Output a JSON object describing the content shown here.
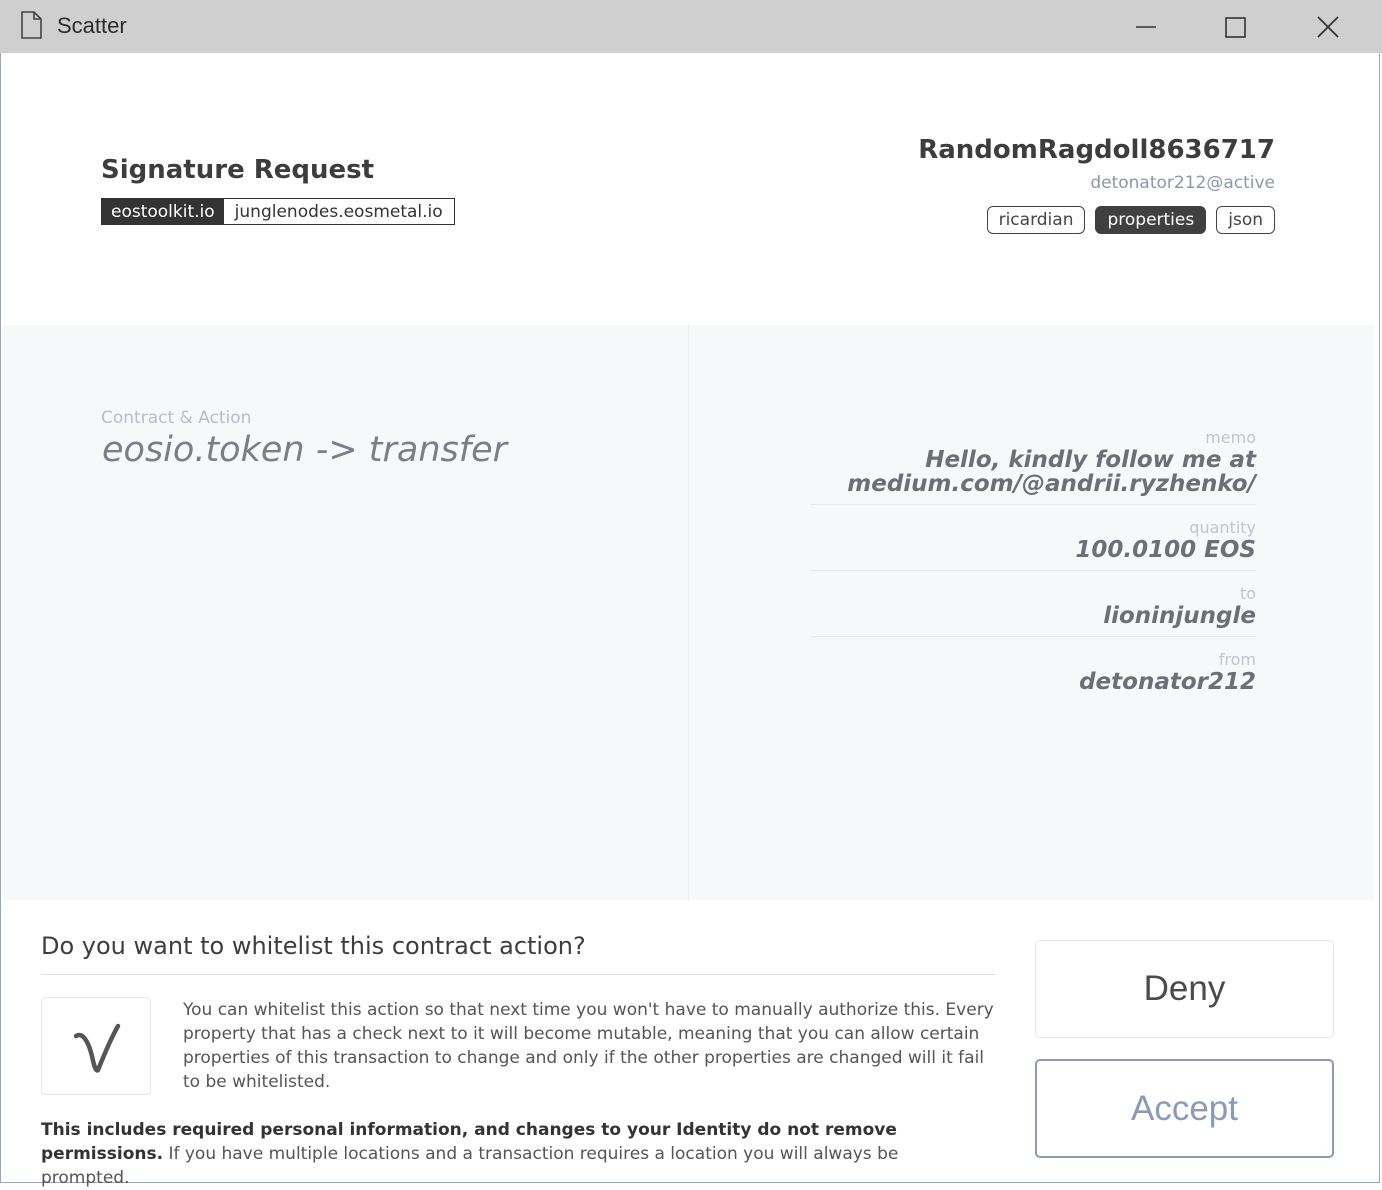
{
  "window": {
    "title": "Scatter",
    "controls": [
      "minimize",
      "maximize",
      "close"
    ]
  },
  "header": {
    "title": "Signature Request",
    "origin_app": "eostoolkit.io",
    "origin_network": "junglenodes.eosmetal.io",
    "account_name": "RandomRagdoll8636717",
    "account_permission": "detonator212@active",
    "tabs": [
      {
        "label": "ricardian",
        "active": false
      },
      {
        "label": "properties",
        "active": true
      },
      {
        "label": "json",
        "active": false
      }
    ]
  },
  "action": {
    "label": "Contract & Action",
    "value": "eosio.token -> transfer"
  },
  "properties": [
    {
      "key": "memo",
      "value_line1": "Hello, kindly follow me at",
      "value_line2": "medium.com/@andrii.ryzhenko/"
    },
    {
      "key": "quantity",
      "value_line1": "100.0100 EOS"
    },
    {
      "key": "to",
      "value_line1": "lioninjungle"
    },
    {
      "key": "from",
      "value_line1": "detonator212"
    }
  ],
  "whitelist": {
    "question": "Do you want to whitelist this contract action?",
    "description": "You can whitelist this action so that next time you won't have to manually authorize this. Every property that has a check next to it will become mutable, meaning that you can allow certain properties of this transaction to change and only if the other properties are changed will it fail to be whitelisted.",
    "note_bold": "This includes required personal information, and changes to your Identity do not remove permissions.",
    "note_rest": " If you have multiple locations and a transaction requires a location you will always be prompted."
  },
  "buttons": {
    "deny": "Deny",
    "accept": "Accept"
  },
  "colors": {
    "titlebar": "#cfcfcf",
    "accent": "#8b9bb6",
    "content_bg": "#f7f8f9"
  }
}
